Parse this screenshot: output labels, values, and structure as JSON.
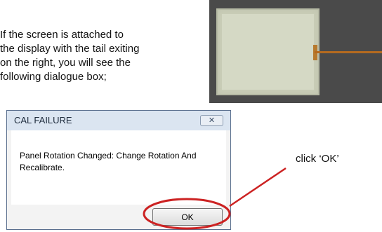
{
  "intro_text": "If the screen is attached to\nthe display with the tail exiting\non the right, you will see the\nfollowing dialogue box;",
  "dialog": {
    "title": "CAL FAILURE",
    "close_glyph": "✕",
    "message": "Panel Rotation Changed: Change Rotation And Recalibrate.",
    "ok_label": "OK"
  },
  "callout": {
    "text": "click ‘OK’",
    "color": "#cc2222"
  }
}
